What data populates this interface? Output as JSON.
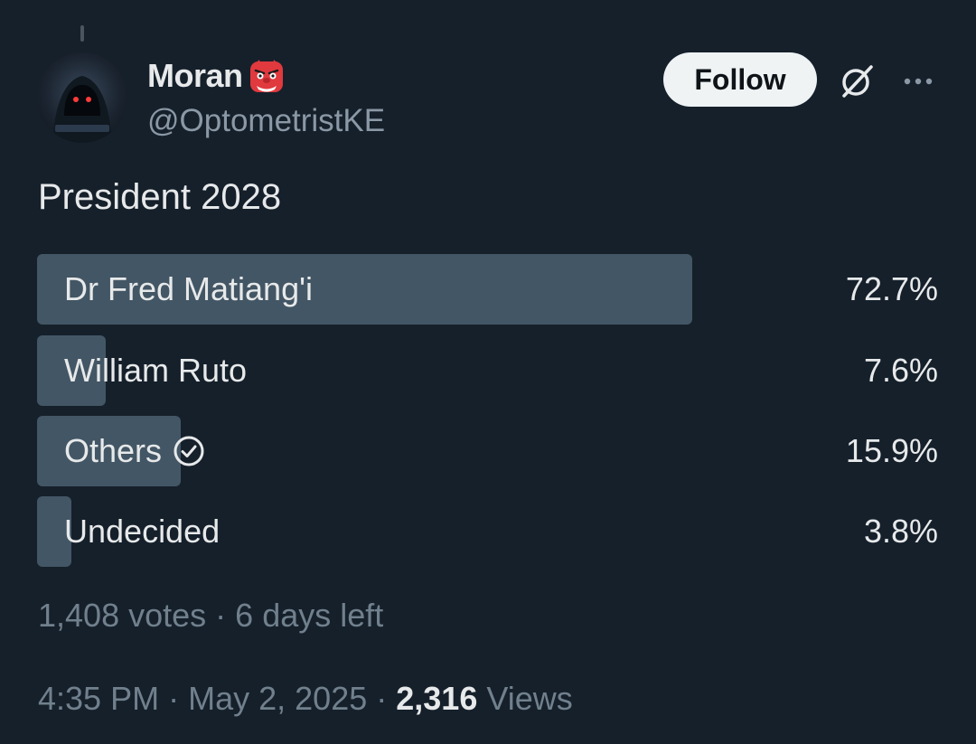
{
  "author": {
    "display_name": "Moran",
    "handle": "@OptometristKE",
    "badge_icon": "goblin-emoji-icon"
  },
  "actions": {
    "follow_label": "Follow",
    "grok_icon": "grok-icon",
    "more_icon": "more-icon"
  },
  "poll": {
    "question": "President 2028",
    "options": [
      {
        "label": "Dr Fred Matiang'i",
        "percent": "72.7%",
        "value": 72.7,
        "selected": false
      },
      {
        "label": "William Ruto",
        "percent": "7.6%",
        "value": 7.6,
        "selected": false
      },
      {
        "label": "Others",
        "percent": "15.9%",
        "value": 15.9,
        "selected": true
      },
      {
        "label": "Undecided",
        "percent": "3.8%",
        "value": 3.8,
        "selected": false
      }
    ],
    "votes": "1,408 votes",
    "separator": "·",
    "time_left": "6 days left"
  },
  "tweet": {
    "time": "4:35 PM",
    "separator": "·",
    "date": "May 2, 2025",
    "views_count": "2,316",
    "views_label": "Views"
  },
  "colors": {
    "background": "#15202b",
    "bar_fill": "#435665",
    "text": "#e7e9ea",
    "muted": "#71808d"
  }
}
